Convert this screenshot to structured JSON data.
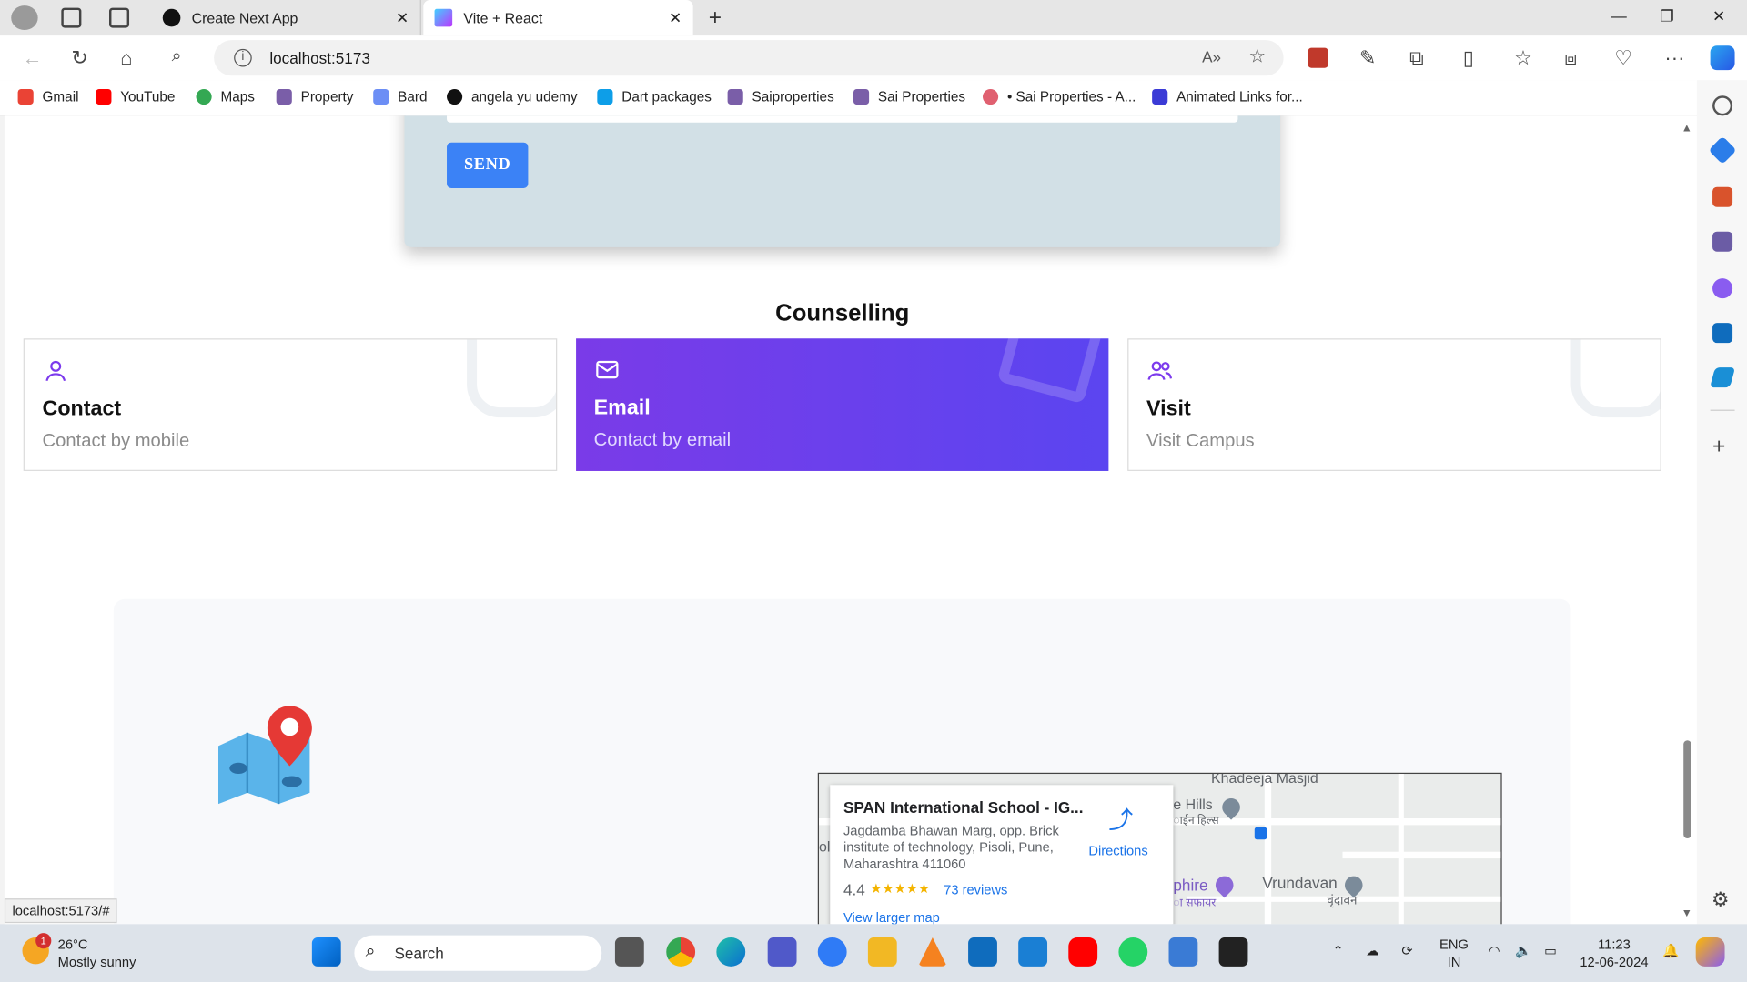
{
  "browser": {
    "tabs": [
      {
        "label": "Create Next App",
        "active": false
      },
      {
        "label": "Vite + React",
        "active": true
      }
    ],
    "url": "localhost:5173",
    "bookmarks": [
      "Gmail",
      "YouTube",
      "Maps",
      "Property",
      "Bard",
      "angela yu udemy",
      "Dart packages",
      "Saiproperties",
      "Sai Properties",
      "• Sai Properties - A...",
      "Animated Links for..."
    ],
    "status_url": "localhost:5173/#"
  },
  "form": {
    "send_label": "SEND"
  },
  "counselling": {
    "heading": "Counselling",
    "cards": [
      {
        "title": "Contact",
        "subtitle": "Contact by mobile",
        "icon": "user-icon"
      },
      {
        "title": "Email",
        "subtitle": "Contact by email",
        "icon": "mail-icon"
      },
      {
        "title": "Visit",
        "subtitle": "Visit Campus",
        "icon": "users-icon"
      }
    ]
  },
  "map": {
    "place_name": "SPAN International School - IG...",
    "address": "Jagdamba Bhawan Marg, opp. Brick institute of technology, Pisoli, Pune, Maharashtra 411060",
    "rating": "4.4",
    "stars": "★★★★★",
    "reviews": "73 reviews",
    "directions": "Directions",
    "view_larger": "View larger map",
    "labels": {
      "masjid": "Khadeeja Masjid",
      "hills": "e Hills",
      "hills_hi": "ाईन हिल्स",
      "vrundavan": "Vrundavan",
      "vrundavan_hi": "वृंदावन",
      "sapphire": "phire",
      "sapphire_hi": "ा सफायर",
      "ol": "ol"
    }
  },
  "taskbar": {
    "temperature": "26°C",
    "weather": "Mostly sunny",
    "weather_badge": "1",
    "search_placeholder": "Search",
    "lang": "ENG",
    "region": "IN",
    "time": "11:23",
    "date": "12-06-2024"
  },
  "colors": {
    "send": "#3b82f6",
    "email_card_start": "#7a3be8",
    "email_card_end": "#5b45f0",
    "card_icon": "#7c3aed"
  }
}
